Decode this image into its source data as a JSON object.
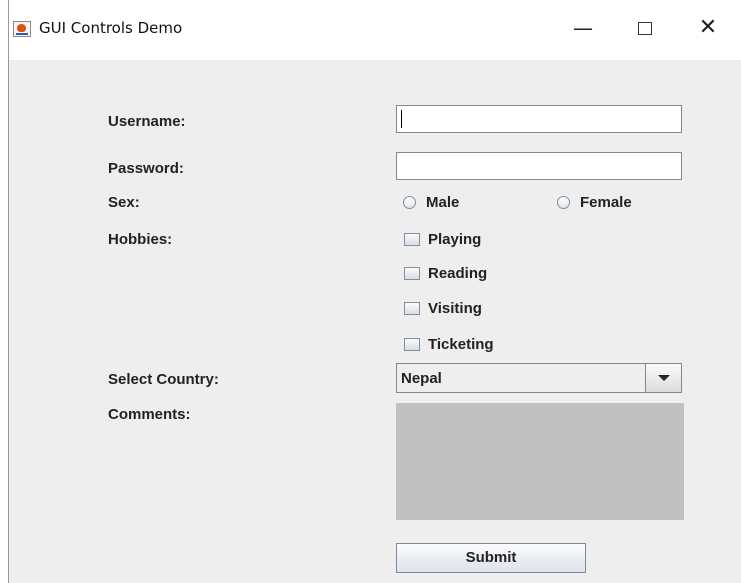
{
  "window": {
    "title": "GUI Controls Demo",
    "controls": {
      "minimize": "—",
      "close": "✕"
    }
  },
  "form": {
    "username": {
      "label": "Username:",
      "value": ""
    },
    "password": {
      "label": "Password:",
      "value": ""
    },
    "sex": {
      "label": "Sex:",
      "options": [
        "Male",
        "Female"
      ],
      "selected": null
    },
    "hobbies": {
      "label": "Hobbies:",
      "options": [
        "Playing",
        "Reading",
        "Visiting",
        "Ticketing"
      ],
      "checked": []
    },
    "country": {
      "label": "Select Country:",
      "selected": "Nepal"
    },
    "comments": {
      "label": "Comments:",
      "value": ""
    },
    "submit_label": "Submit"
  },
  "colors": {
    "panel_bg": "#eeeeee",
    "comments_bg": "#c0c0c0",
    "field_border": "#7a8a9a"
  }
}
